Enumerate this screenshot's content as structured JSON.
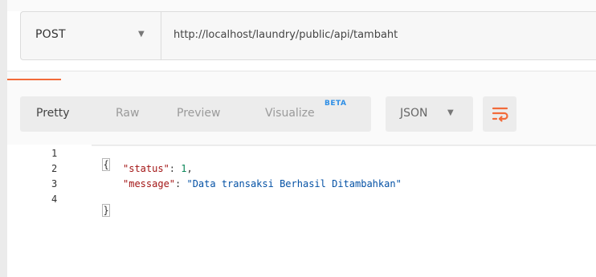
{
  "request": {
    "method": "POST",
    "url": "http://localhost/laundry/public/api/tambaht"
  },
  "response_toolbar": {
    "tabs": [
      {
        "label": "Pretty",
        "active": true
      },
      {
        "label": "Raw",
        "active": false
      },
      {
        "label": "Preview",
        "active": false
      },
      {
        "label": "Visualize",
        "active": false
      }
    ],
    "visualize_badge": "BETA",
    "format": "JSON",
    "wrap_icon": "wrap-lines-icon"
  },
  "body": {
    "line_numbers": [
      "1",
      "2",
      "3",
      "4"
    ],
    "lines": {
      "open_brace": "{",
      "status_key": "\"status\"",
      "colon": ": ",
      "status_value": "1",
      "comma": ",",
      "message_key": "\"message\"",
      "message_value": "\"Data transaksi Berhasil Ditambahkan\"",
      "close_brace": "}"
    }
  },
  "colors": {
    "accent": "#f26b3a",
    "beta": "#2f8fe6",
    "json_key": "#a31515",
    "json_number": "#098658",
    "json_string": "#0451a5"
  }
}
